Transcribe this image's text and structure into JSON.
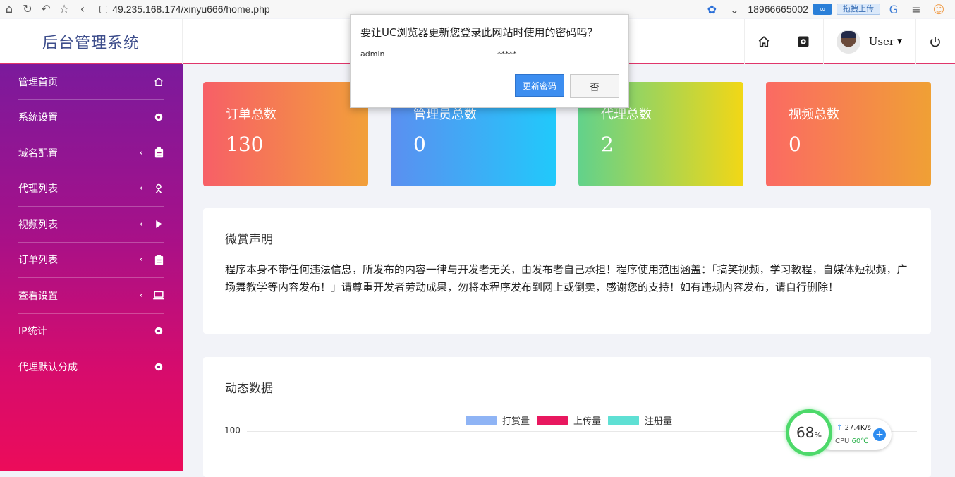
{
  "browser": {
    "url": "49.235.168.174/xinyu666/home.php",
    "phone": "18966665002",
    "upload_label": "拖拽上传",
    "icons": [
      "home-icon",
      "refresh-icon",
      "undo-icon",
      "star-icon",
      "back-icon"
    ]
  },
  "header": {
    "brand": "后台管理系统",
    "user_name": "User"
  },
  "sidebar": {
    "items": [
      {
        "label": "管理首页",
        "icon": "home-icon",
        "has_chevron": false
      },
      {
        "label": "系统设置",
        "icon": "gear-icon",
        "has_chevron": false
      },
      {
        "label": "域名配置",
        "icon": "clipboard-icon",
        "has_chevron": true
      },
      {
        "label": "代理列表",
        "icon": "user-icon",
        "has_chevron": true
      },
      {
        "label": "视频列表",
        "icon": "play-icon",
        "has_chevron": true
      },
      {
        "label": "订单列表",
        "icon": "clipboard-icon",
        "has_chevron": true
      },
      {
        "label": "查看设置",
        "icon": "laptop-icon",
        "has_chevron": true
      },
      {
        "label": "IP统计",
        "icon": "gear-icon",
        "has_chevron": false
      },
      {
        "label": "代理默认分成",
        "icon": "gear-icon",
        "has_chevron": false
      }
    ]
  },
  "cards": [
    {
      "title": "订单总数",
      "value": "130",
      "gradient": [
        "#f75f67",
        "#f2a03a"
      ]
    },
    {
      "title": "管理员总数",
      "value": "0",
      "gradient": [
        "#5b8ff0",
        "#21c9fb"
      ]
    },
    {
      "title": "代理总数",
      "value": "2",
      "gradient": [
        "#62d28b",
        "#f2d716"
      ]
    },
    {
      "title": "视频总数",
      "value": "0",
      "gradient": [
        "#fb6a63",
        "#f0a035"
      ]
    }
  ],
  "notice": {
    "title": "微赏声明",
    "text": "程序本身不带任何违法信息，所发布的内容一律与开发者无关，由发布者自己承担！程序使用范围涵盖：「搞笑视频，学习教程，自媒体短视频，广场舞教学等内容发布！」请尊重开发者劳动成果，勿将本程序发布到网上或倒卖，感谢您的支持！如有违规内容发布，请自行删除！"
  },
  "dynamic": {
    "title": "动态数据",
    "axis_top": "100",
    "legend": [
      {
        "label": "打赏量",
        "color": "#8fb4f5"
      },
      {
        "label": "上传量",
        "color": "#e8185f"
      },
      {
        "label": "注册量",
        "color": "#5fe0d4"
      }
    ]
  },
  "password_dialog": {
    "title": "要让UC浏览器更新您登录此网站时使用的密码吗？",
    "username": "admin",
    "password_mask": "*****",
    "update_label": "更新密码",
    "no_label": "否"
  },
  "cpu_widget": {
    "usage": "68",
    "usage_unit": "%",
    "speed": "27.4K/s",
    "cpu_label": "CPU",
    "temp": "60℃"
  }
}
